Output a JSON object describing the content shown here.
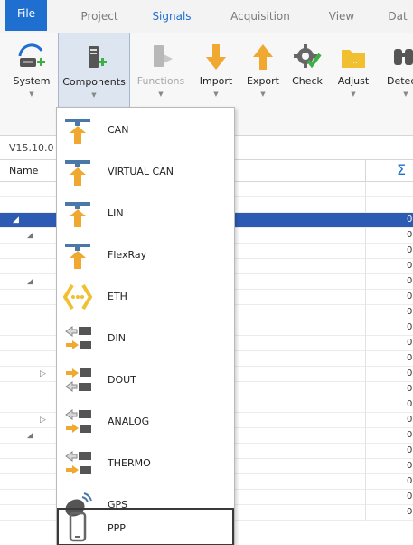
{
  "menu": {
    "tabs": [
      "File",
      "Project",
      "Signals",
      "Acquisition",
      "View",
      "Dat"
    ],
    "active": "Signals"
  },
  "ribbon": {
    "buttons": [
      {
        "label": "System",
        "icon": "system-device-add-icon"
      },
      {
        "label": "Components",
        "icon": "component-add-icon"
      },
      {
        "label": "Functions",
        "icon": "functions-icon"
      },
      {
        "label": "Import",
        "icon": "import-arrow-icon"
      },
      {
        "label": "Export",
        "icon": "export-arrow-icon"
      },
      {
        "label": "Check",
        "icon": "check-gear-icon"
      },
      {
        "label": "Adjust",
        "icon": "adjust-folder-icon"
      },
      {
        "label": "Detec",
        "icon": "detect-binoculars-icon"
      }
    ]
  },
  "version": "V15.10.0",
  "table": {
    "name_header": "Name",
    "sum_header": "Σ",
    "values": [
      "0",
      "0",
      "0",
      "0",
      "0",
      "0",
      "0",
      "0",
      "0",
      "0",
      "0",
      "0",
      "0",
      "0",
      "0",
      "0",
      "0",
      "0",
      "0",
      "0"
    ]
  },
  "dropdown": {
    "items": [
      {
        "label": "CAN",
        "icon": "can-bus-icon"
      },
      {
        "label": "VIRTUAL CAN",
        "icon": "virtual-can-icon"
      },
      {
        "label": "LIN",
        "icon": "lin-bus-icon"
      },
      {
        "label": "FlexRay",
        "icon": "flexray-icon"
      },
      {
        "label": "ETH",
        "icon": "ethernet-icon"
      },
      {
        "label": "DIN",
        "icon": "digital-input-icon"
      },
      {
        "label": "DOUT",
        "icon": "digital-output-icon"
      },
      {
        "label": "ANALOG",
        "icon": "analog-icon"
      },
      {
        "label": "THERMO",
        "icon": "thermo-icon"
      },
      {
        "label": "GPS",
        "icon": "gps-satellite-icon"
      },
      {
        "label": "PPP",
        "icon": "ppp-phone-icon"
      }
    ]
  },
  "colors": {
    "accent": "#1e6fd0",
    "selected_row": "#2d5bb3",
    "orange": "#f0a830",
    "green": "#3cb043"
  }
}
